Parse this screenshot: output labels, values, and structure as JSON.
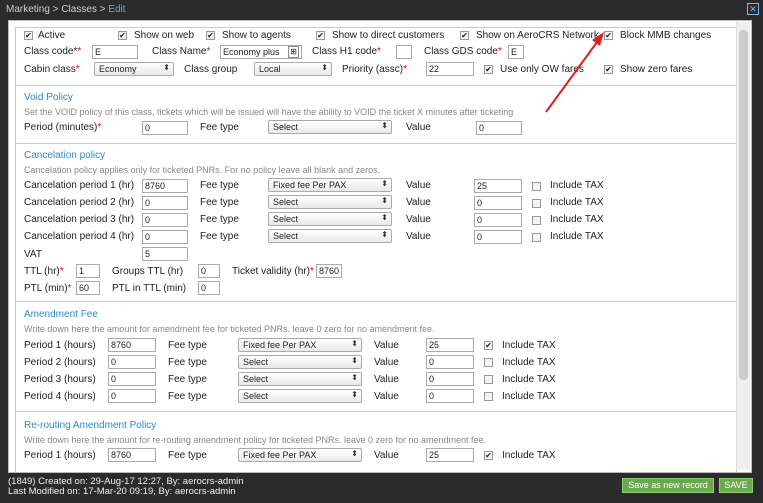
{
  "breadcrumb": {
    "part1": "Marketing",
    "part2": "Classes",
    "current": "Edit"
  },
  "top": {
    "checks": [
      {
        "label": "Active",
        "checked": true
      },
      {
        "label": "Show on web",
        "checked": true
      },
      {
        "label": "Show to agents",
        "checked": true
      },
      {
        "label": "Show to direct customers",
        "checked": true
      },
      {
        "label": "Show on AeroCRS Network",
        "checked": true
      },
      {
        "label": "Block MMB changes",
        "checked": true
      }
    ],
    "class_code_label": "Class code*",
    "class_code_req": "*",
    "class_code": "E",
    "class_name_label": "Class Name",
    "class_name": "Economy plus",
    "class_h1_label": "Class H1 code",
    "class_h1": "",
    "class_gds_label": "Class GDS code",
    "class_gds": "E",
    "cabin_label": "Cabin class",
    "cabin": "Economy",
    "group_label": "Class group",
    "group": "Local",
    "priority_label": "Priority (assc)",
    "priority": "22",
    "ow_label": "Use only OW fares",
    "zero_label": "Show zero fares"
  },
  "void": {
    "title": "Void Policy",
    "desc": "Set the VOID policy of this class, tickets which will be issued will have the ability to VOID the ticket X minutes after ticketing",
    "period_label": "Period (minutes)",
    "period": "0",
    "fee_type_label": "Fee type",
    "fee_type": "Select",
    "value_label": "Value",
    "value": "0"
  },
  "cancel": {
    "title": "Cancelation policy",
    "desc": "Cancelation policy applies only for ticketed PNRs. For no policy leave all blank and zeros.",
    "fee_type_label": "Fee type",
    "value_label": "Value",
    "tax_label": "Include TAX",
    "rows": [
      {
        "label": "Cancelation period 1 (hr)",
        "period": "8760",
        "fee": "Fixed fee Per PAX",
        "value": "25"
      },
      {
        "label": "Cancelation period 2 (hr)",
        "period": "0",
        "fee": "Select",
        "value": "0"
      },
      {
        "label": "Cancelation period 3 (hr)",
        "period": "0",
        "fee": "Select",
        "value": "0"
      },
      {
        "label": "Cancelation period 4 (hr)",
        "period": "0",
        "fee": "Select",
        "value": "0"
      }
    ],
    "vat_label": "VAT",
    "vat": "5",
    "ttl_label": "TTL (hr)",
    "ttl": "1",
    "groups_ttl_label": "Groups TTL (hr)",
    "groups_ttl": "0",
    "validity_label": "Ticket validity (hr)",
    "validity": "8760",
    "ptl_label": "PTL (min)",
    "ptl": "60",
    "ptl_in_ttl_label": "PTL in TTL (min)",
    "ptl_in_ttl": "0"
  },
  "amend": {
    "title": "Amendment Fee",
    "desc": "Write down here the amount for amendment fee for ticketed PNRs. leave 0 zero for no amendment fee.",
    "fee_type_label": "Fee type",
    "value_label": "Value",
    "tax_label": "Include TAX",
    "rows": [
      {
        "label": "Period 1 (hours)",
        "period": "8760",
        "fee": "Fixed fee Per PAX",
        "value": "25",
        "tax": true
      },
      {
        "label": "Period 2 (hours)",
        "period": "0",
        "fee": "Select",
        "value": "0",
        "tax": false
      },
      {
        "label": "Period 3 (hours)",
        "period": "0",
        "fee": "Select",
        "value": "0",
        "tax": false
      },
      {
        "label": "Period 4 (hours)",
        "period": "0",
        "fee": "Select",
        "value": "0",
        "tax": false
      }
    ]
  },
  "reroute": {
    "title": "Re-routing Amendment Policy",
    "desc": "Write down here the amount for re-routing amendment policy for ticketed PNRs. leave 0 zero for no amendment fee.",
    "rows": [
      {
        "label": "Period 1 (hours)",
        "period": "8760",
        "fee": "Fixed fee Per PAX",
        "value": "25",
        "tax": true
      }
    ]
  },
  "footer": {
    "created": "(1849) Created on: 29-Aug-17 12:27, By: aerocrs-admin",
    "modified": "Last Modified on: 17-Mar-20 09:19, By: aerocrs-admin",
    "save_new": "Save as new record",
    "save": "SAVE"
  },
  "colors": {
    "accent": "#2a8bd0",
    "button": "#6aa84f",
    "arrow": "#e02020"
  }
}
